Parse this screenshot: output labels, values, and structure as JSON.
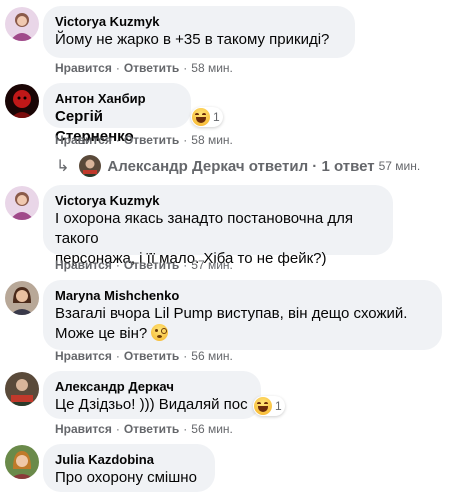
{
  "actions": {
    "like": "Нравится",
    "reply": "Ответить",
    "separator": "·"
  },
  "comments": [
    {
      "author": "Victorya Kuzmyk",
      "text": "Йому не жарко в +35 в такому прикиді?",
      "time": "58 мин."
    },
    {
      "author": "Антон Ханбир",
      "text": "Сергій Стерненко",
      "time": "58 мин.",
      "reaction_count": "1"
    },
    {
      "author": "Victorya Kuzmyk",
      "text_line1": "І охорона якась занадто постановочна для такого",
      "text_line2": "персонажа, і її мало. Хіба то не фейк?)",
      "time": "57 мин."
    },
    {
      "author": "Maryna Mishchenko",
      "text_line1": "Взагалі вчора Lil Pump виступав, він дещо схожий.",
      "text_line2": "Може це він?",
      "time": "56 мин."
    },
    {
      "author": "Александр Деркач",
      "text": "Це Дзідзьо! ))) Видаляй пос",
      "time": "56 мин.",
      "reaction_count": "1"
    },
    {
      "author": "Julia Kazdobina",
      "text": "Про охорону смішно"
    }
  ],
  "reply_thread": {
    "arrow": "↳",
    "text": "Александр Деркач ответил · 1 ответ",
    "time": "57 мин."
  },
  "colors": {
    "bubble": "#f0f2f5",
    "meta": "#65676b",
    "text": "#050505"
  }
}
